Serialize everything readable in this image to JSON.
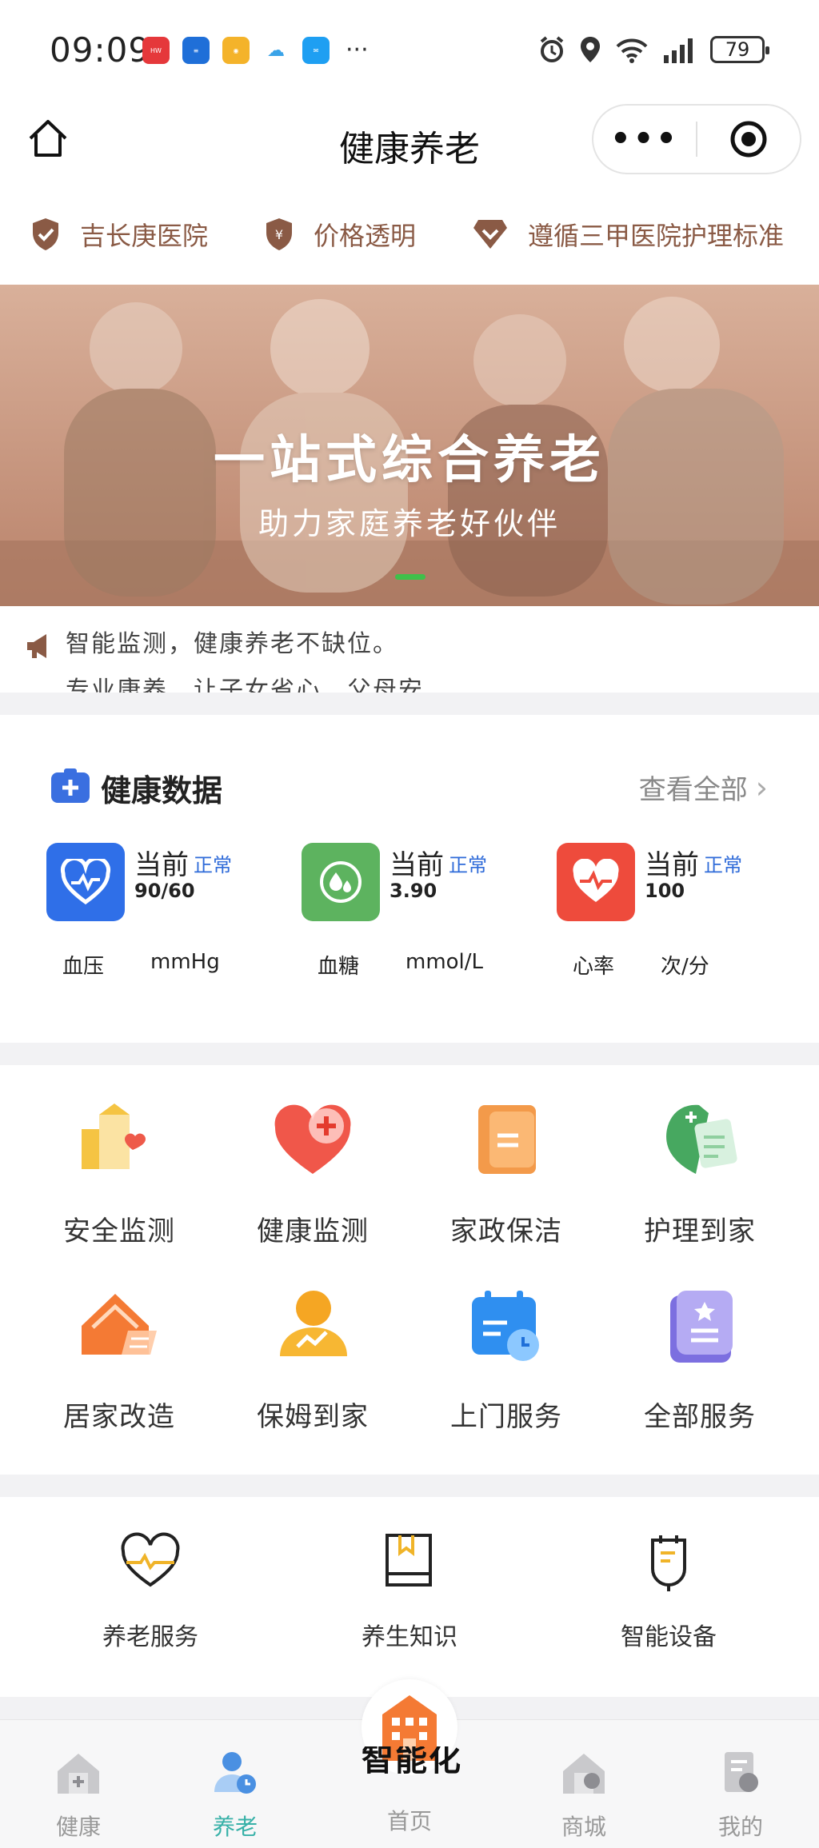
{
  "status_bar": {
    "time": "09:09",
    "apps": [
      "huawei-app-icon",
      "docs-app-icon",
      "weibo-app-icon",
      "chat-bubble-app-icon",
      "message-app-icon"
    ],
    "more": "···",
    "battery": "79"
  },
  "navbar": {
    "title": "健康养老"
  },
  "badges": [
    {
      "label": "吉长庚医院",
      "icon": "shield-check-icon"
    },
    {
      "label": "价格透明",
      "icon": "shield-yen-icon"
    },
    {
      "label": "遵循三甲医院护理标准",
      "icon": "diamond-check-icon"
    }
  ],
  "banner": {
    "title": "一站式综合养老",
    "subtitle": "助力家庭养老好伙伴"
  },
  "notice": {
    "line1": "智能监测，健康养老不缺位。",
    "line2": "专业康养，让子女省心、父母安"
  },
  "health": {
    "title": "健康数据",
    "view_all": "查看全部",
    "metrics": [
      {
        "current": "当前",
        "status": "正常",
        "value": "90/60",
        "name": "血压",
        "unit": "mmHg",
        "color": "#2f6fe8"
      },
      {
        "current": "当前",
        "status": "正常",
        "value": "3.90",
        "name": "血糖",
        "unit": "mmol/L",
        "color": "#5db35f"
      },
      {
        "current": "当前",
        "status": "正常",
        "value": "100",
        "name": "心率",
        "unit": "次/分",
        "color": "#ee4b3c"
      }
    ]
  },
  "services": [
    {
      "label": "安全监测",
      "icon": "safety-monitor-icon"
    },
    {
      "label": "健康监测",
      "icon": "health-monitor-icon"
    },
    {
      "label": "家政保洁",
      "icon": "housekeeping-icon"
    },
    {
      "label": "护理到家",
      "icon": "home-nursing-icon"
    },
    {
      "label": "居家改造",
      "icon": "home-renovation-icon"
    },
    {
      "label": "保姆到家",
      "icon": "nanny-icon"
    },
    {
      "label": "上门服务",
      "icon": "door-service-icon"
    },
    {
      "label": "全部服务",
      "icon": "all-services-icon"
    }
  ],
  "sub_services": [
    {
      "label": "养老服务",
      "icon": "heart-pulse-icon"
    },
    {
      "label": "养生知识",
      "icon": "book-icon"
    },
    {
      "label": "智能设备",
      "icon": "device-icon"
    }
  ],
  "tabbar": {
    "tabs": [
      {
        "label": "健康"
      },
      {
        "label": "养老"
      },
      {
        "label": "首页"
      },
      {
        "label": "商城"
      },
      {
        "label": "我的"
      }
    ],
    "center_watermark": "智能化"
  },
  "colors": {
    "accent": "#38b1a8",
    "badge_brown": "#8a5a45",
    "status_blue": "#2f6bd9"
  }
}
